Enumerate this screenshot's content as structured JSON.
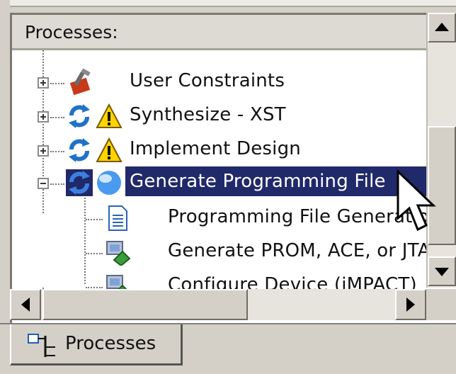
{
  "panel": {
    "header_title": "Processes:"
  },
  "tree": {
    "items": [
      {
        "label": "User Constraints",
        "icon": "constraints-tools-icon",
        "expander": "plus"
      },
      {
        "label": "Synthesize - XST",
        "icon": "refresh-warning-icon",
        "expander": "plus"
      },
      {
        "label": "Implement Design",
        "icon": "refresh-warning-icon",
        "expander": "plus"
      },
      {
        "label": "Generate Programming File",
        "icon": "refresh-running-icon",
        "expander": "minus",
        "selected": true
      },
      {
        "label": "Programming File Generatio",
        "icon": "document-icon",
        "child": true
      },
      {
        "label": "Generate PROM, ACE, or JTA",
        "icon": "device-program-icon",
        "child": true
      },
      {
        "label": "Configure Device (iMPACT)",
        "icon": "device-program-icon",
        "child": true
      }
    ]
  },
  "tabs": [
    {
      "label": "Processes",
      "icon": "processes-hierarchy-icon",
      "active": true
    }
  ],
  "colors": {
    "selection": "#20296a",
    "background": "#d4d0c8",
    "tree_bg": "#ffffff"
  }
}
